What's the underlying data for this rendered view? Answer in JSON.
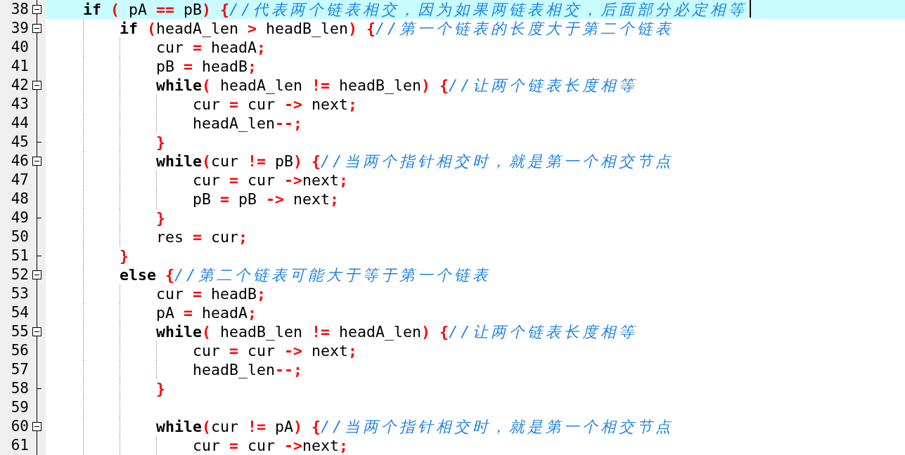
{
  "editor": {
    "lines": [
      {
        "number": "38",
        "kind": "opener",
        "current": true,
        "caret": true,
        "tokens": [
          {
            "kind": "keyword",
            "text": "    if "
          },
          {
            "kind": "operator",
            "text": "("
          },
          {
            "kind": "plain",
            "text": " pA "
          },
          {
            "kind": "operator",
            "text": "=="
          },
          {
            "kind": "plain",
            "text": " pB"
          },
          {
            "kind": "operator",
            "text": ") {"
          },
          {
            "kind": "comment",
            "text": "//代表两个链表相交，因为如果两链表相交，后面部分必定相等"
          }
        ]
      },
      {
        "number": "39",
        "kind": "opener",
        "current": false,
        "caret": false,
        "tokens": [
          {
            "kind": "keyword",
            "text": "        if "
          },
          {
            "kind": "operator",
            "text": "("
          },
          {
            "kind": "plain",
            "text": "headA_len "
          },
          {
            "kind": "operator",
            "text": ">"
          },
          {
            "kind": "plain",
            "text": " headB_len"
          },
          {
            "kind": "operator",
            "text": ") {"
          },
          {
            "kind": "comment",
            "text": "//第一个链表的长度大于第二个链表"
          }
        ]
      },
      {
        "number": "40",
        "kind": "body",
        "current": false,
        "caret": false,
        "tokens": [
          {
            "kind": "plain",
            "text": "            cur "
          },
          {
            "kind": "operator",
            "text": "="
          },
          {
            "kind": "plain",
            "text": " headA"
          },
          {
            "kind": "operator",
            "text": ";"
          }
        ]
      },
      {
        "number": "41",
        "kind": "body",
        "current": false,
        "caret": false,
        "tokens": [
          {
            "kind": "plain",
            "text": "            pB "
          },
          {
            "kind": "operator",
            "text": "="
          },
          {
            "kind": "plain",
            "text": " headB"
          },
          {
            "kind": "operator",
            "text": ";"
          }
        ]
      },
      {
        "number": "42",
        "kind": "opener",
        "current": false,
        "caret": false,
        "tokens": [
          {
            "kind": "keyword",
            "text": "            while"
          },
          {
            "kind": "operator",
            "text": "("
          },
          {
            "kind": "plain",
            "text": " headA_len "
          },
          {
            "kind": "operator",
            "text": "!="
          },
          {
            "kind": "plain",
            "text": " headB_len"
          },
          {
            "kind": "operator",
            "text": ") {"
          },
          {
            "kind": "comment",
            "text": "//让两个链表长度相等"
          }
        ]
      },
      {
        "number": "43",
        "kind": "body",
        "current": false,
        "caret": false,
        "tokens": [
          {
            "kind": "plain",
            "text": "                cur "
          },
          {
            "kind": "operator",
            "text": "="
          },
          {
            "kind": "plain",
            "text": " cur "
          },
          {
            "kind": "operator",
            "text": "->"
          },
          {
            "kind": "plain",
            "text": " next"
          },
          {
            "kind": "operator",
            "text": ";"
          }
        ]
      },
      {
        "number": "44",
        "kind": "body",
        "current": false,
        "caret": false,
        "tokens": [
          {
            "kind": "plain",
            "text": "                headA_len"
          },
          {
            "kind": "operator",
            "text": "--;"
          }
        ]
      },
      {
        "number": "45",
        "kind": "closer",
        "current": false,
        "caret": false,
        "tokens": [
          {
            "kind": "operator",
            "text": "            }"
          }
        ]
      },
      {
        "number": "46",
        "kind": "opener",
        "current": false,
        "caret": false,
        "tokens": [
          {
            "kind": "keyword",
            "text": "            while"
          },
          {
            "kind": "operator",
            "text": "("
          },
          {
            "kind": "plain",
            "text": "cur "
          },
          {
            "kind": "operator",
            "text": "!="
          },
          {
            "kind": "plain",
            "text": " pB"
          },
          {
            "kind": "operator",
            "text": ") {"
          },
          {
            "kind": "comment",
            "text": "//当两个指针相交时，就是第一个相交节点"
          }
        ]
      },
      {
        "number": "47",
        "kind": "body",
        "current": false,
        "caret": false,
        "tokens": [
          {
            "kind": "plain",
            "text": "                cur "
          },
          {
            "kind": "operator",
            "text": "="
          },
          {
            "kind": "plain",
            "text": " cur "
          },
          {
            "kind": "operator",
            "text": "->"
          },
          {
            "kind": "plain",
            "text": "next"
          },
          {
            "kind": "operator",
            "text": ";"
          }
        ]
      },
      {
        "number": "48",
        "kind": "body",
        "current": false,
        "caret": false,
        "tokens": [
          {
            "kind": "plain",
            "text": "                pB "
          },
          {
            "kind": "operator",
            "text": "="
          },
          {
            "kind": "plain",
            "text": " pB "
          },
          {
            "kind": "operator",
            "text": "->"
          },
          {
            "kind": "plain",
            "text": " next"
          },
          {
            "kind": "operator",
            "text": ";"
          }
        ]
      },
      {
        "number": "49",
        "kind": "closer",
        "current": false,
        "caret": false,
        "tokens": [
          {
            "kind": "operator",
            "text": "            }"
          }
        ]
      },
      {
        "number": "50",
        "kind": "body",
        "current": false,
        "caret": false,
        "tokens": [
          {
            "kind": "plain",
            "text": "            res "
          },
          {
            "kind": "operator",
            "text": "="
          },
          {
            "kind": "plain",
            "text": " cur"
          },
          {
            "kind": "operator",
            "text": ";"
          }
        ]
      },
      {
        "number": "51",
        "kind": "closer",
        "current": false,
        "caret": false,
        "tokens": [
          {
            "kind": "operator",
            "text": "        }"
          }
        ]
      },
      {
        "number": "52",
        "kind": "opener",
        "current": false,
        "caret": false,
        "tokens": [
          {
            "kind": "keyword",
            "text": "        else "
          },
          {
            "kind": "operator",
            "text": "{"
          },
          {
            "kind": "comment",
            "text": "//第二个链表可能大于等于第一个链表"
          }
        ]
      },
      {
        "number": "53",
        "kind": "body",
        "current": false,
        "caret": false,
        "tokens": [
          {
            "kind": "plain",
            "text": "            cur "
          },
          {
            "kind": "operator",
            "text": "="
          },
          {
            "kind": "plain",
            "text": " headB"
          },
          {
            "kind": "operator",
            "text": ";"
          }
        ]
      },
      {
        "number": "54",
        "kind": "body",
        "current": false,
        "caret": false,
        "tokens": [
          {
            "kind": "plain",
            "text": "            pA "
          },
          {
            "kind": "operator",
            "text": "="
          },
          {
            "kind": "plain",
            "text": " headA"
          },
          {
            "kind": "operator",
            "text": ";"
          }
        ]
      },
      {
        "number": "55",
        "kind": "opener",
        "current": false,
        "caret": false,
        "tokens": [
          {
            "kind": "keyword",
            "text": "            while"
          },
          {
            "kind": "operator",
            "text": "("
          },
          {
            "kind": "plain",
            "text": " headB_len "
          },
          {
            "kind": "operator",
            "text": "!="
          },
          {
            "kind": "plain",
            "text": " headA_len"
          },
          {
            "kind": "operator",
            "text": ") {"
          },
          {
            "kind": "comment",
            "text": "//让两个链表长度相等"
          }
        ]
      },
      {
        "number": "56",
        "kind": "body",
        "current": false,
        "caret": false,
        "tokens": [
          {
            "kind": "plain",
            "text": "                cur "
          },
          {
            "kind": "operator",
            "text": "="
          },
          {
            "kind": "plain",
            "text": " cur "
          },
          {
            "kind": "operator",
            "text": "->"
          },
          {
            "kind": "plain",
            "text": " next"
          },
          {
            "kind": "operator",
            "text": ";"
          }
        ]
      },
      {
        "number": "57",
        "kind": "body",
        "current": false,
        "caret": false,
        "tokens": [
          {
            "kind": "plain",
            "text": "                headB_len"
          },
          {
            "kind": "operator",
            "text": "--;"
          }
        ]
      },
      {
        "number": "58",
        "kind": "closer",
        "current": false,
        "caret": false,
        "tokens": [
          {
            "kind": "operator",
            "text": "            }"
          }
        ]
      },
      {
        "number": "59",
        "kind": "body",
        "current": false,
        "caret": false
      },
      {
        "number": "60",
        "kind": "opener",
        "current": false,
        "caret": false,
        "tokens": [
          {
            "kind": "keyword",
            "text": "            while"
          },
          {
            "kind": "operator",
            "text": "("
          },
          {
            "kind": "plain",
            "text": "cur "
          },
          {
            "kind": "operator",
            "text": "!="
          },
          {
            "kind": "plain",
            "text": " pA"
          },
          {
            "kind": "operator",
            "text": ") {"
          },
          {
            "kind": "comment",
            "text": "//当两个指针相交时，就是第一个相交节点"
          }
        ]
      },
      {
        "number": "61",
        "kind": "body",
        "current": false,
        "caret": false,
        "tokens": [
          {
            "kind": "plain",
            "text": "                cur "
          },
          {
            "kind": "operator",
            "text": "="
          },
          {
            "kind": "plain",
            "text": " cur "
          },
          {
            "kind": "operator",
            "text": "->"
          },
          {
            "kind": "plain",
            "text": "next"
          },
          {
            "kind": "operator",
            "text": ";"
          }
        ]
      }
    ]
  }
}
